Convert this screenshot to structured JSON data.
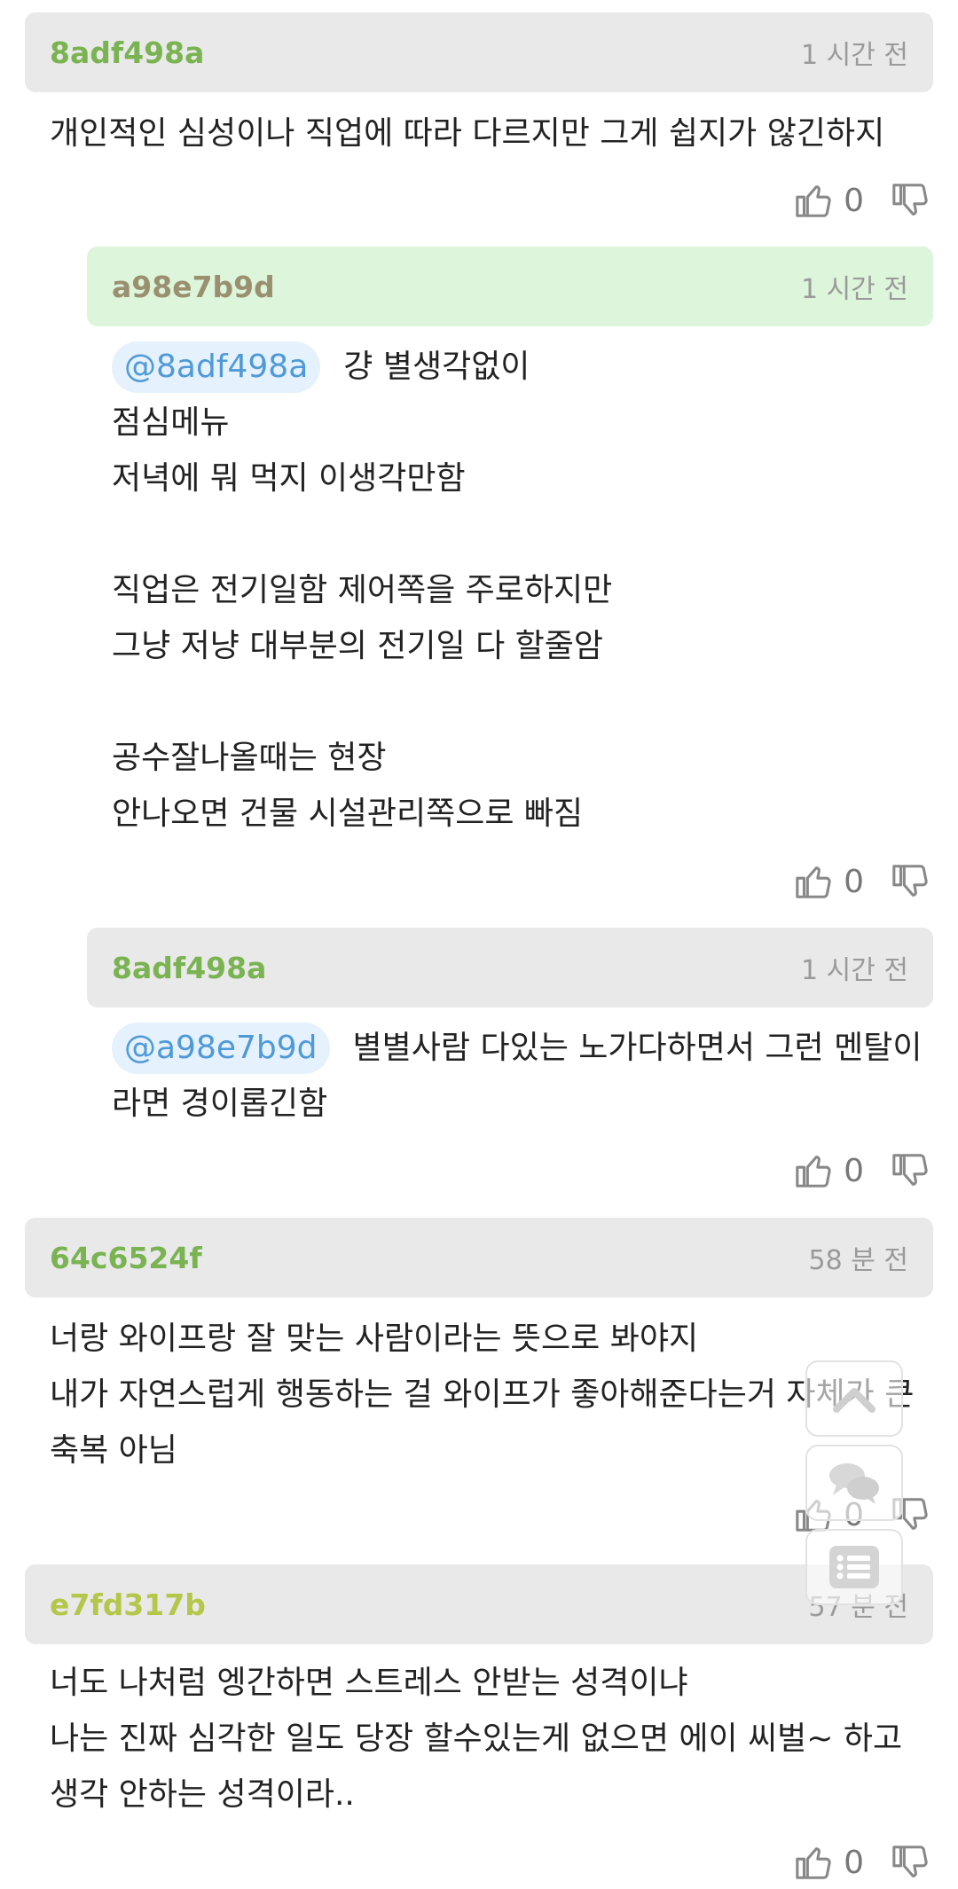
{
  "colors": {
    "author_green": "#7ab351",
    "author_olive": "#9a9070",
    "author_yellowgreen": "#b5c74a",
    "header_gray": "#e9e9e9",
    "header_green": "#dcf5db"
  },
  "comments": [
    {
      "author": "8adf498a",
      "time": "1 시간 전",
      "lines": [
        "개인적인 심성이나 직업에 따라 다르지만 그게 쉽지가 않긴하지"
      ],
      "likes": "0"
    },
    {
      "author": "a98e7b9d",
      "time": "1 시간 전",
      "mention": "@8adf498a",
      "lines": [
        "걍 별생각없이",
        "점심메뉴",
        "저녁에 뭐 먹지 이생각만함",
        "",
        "직업은 전기일함 제어쪽을 주로하지만",
        "그냥 저냥 대부분의 전기일 다 할줄암",
        "",
        "공수잘나올때는 현장",
        "안나오면 건물 시설관리쪽으로 빠짐"
      ],
      "likes": "0"
    },
    {
      "author": "8adf498a",
      "time": "1 시간 전",
      "mention": "@a98e7b9d",
      "lines": [
        "별별사람 다있는 노가다하면서 그런 멘탈이",
        "라면 경이롭긴함"
      ],
      "likes": "0"
    },
    {
      "author": "64c6524f",
      "time": "58 분 전",
      "lines": [
        "너랑 와이프랑 잘 맞는 사람이라는 뜻으로 봐야지",
        "내가 자연스럽게 행동하는 걸 와이프가 좋아해준다는거 자체가 큰",
        "축복 아님"
      ],
      "likes": "0"
    },
    {
      "author": "e7fd317b",
      "time": "57 분 전",
      "lines": [
        "너도 나처럼 엥간하면 스트레스 안받는 성격이냐",
        "나는 진짜 심각한 일도 당장 할수있는게 없으면 에이 씨벌~ 하고",
        "생각 안하는 성격이라.."
      ],
      "likes": "0"
    }
  ],
  "floating_buttons": [
    {
      "icon": "scroll-top-icon"
    },
    {
      "icon": "comments-icon"
    },
    {
      "icon": "list-icon"
    }
  ]
}
